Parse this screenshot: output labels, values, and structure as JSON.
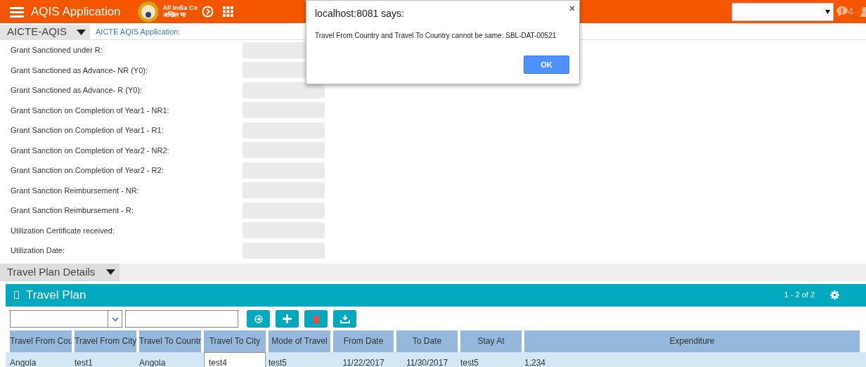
{
  "header": {
    "title": "AQIS Application",
    "logo_lines": [
      "All India Co",
      "अखिल भा"
    ],
    "notification_count": "4"
  },
  "breadcrumb": {
    "screen": "AICTE-AQIS",
    "view": "AICTE AQIS Application:"
  },
  "form_fields": [
    {
      "label": "Grant Sanctioned under R:"
    },
    {
      "label": "Grant Sanctioned as Advance- NR (Y0):"
    },
    {
      "label": "Grant Sanctioned as Advance- R (Y0):"
    },
    {
      "label": "Grant Sanction on Completion of Year1 - NR1:"
    },
    {
      "label": "Grant Sanction on Completion of Year1 - R1:"
    },
    {
      "label": "Grant Sanction on Completion of Year2 - NR2:"
    },
    {
      "label": "Grant Sanction on Completion of Year2 - R2:"
    },
    {
      "label": "Grant Sanction Reimbursement - NR:"
    },
    {
      "label": "Grant Sanction Reimbursement - R:"
    },
    {
      "label": "Utilization Certificate received:"
    },
    {
      "label": "Utilization Date:"
    }
  ],
  "section": {
    "title": "Travel Plan Details"
  },
  "applet": {
    "title": "Travel Plan",
    "record_count": "1 - 2 of 2",
    "columns": [
      "Travel From Cou",
      "Travel From City",
      "Travel To Countr",
      "Travel To City",
      "Mode of Travel",
      "From Date",
      "To Date",
      "Stay At",
      "Expenditure"
    ],
    "rows": [
      {
        "selected": true,
        "cells": [
          {
            "text": "Angola",
            "editing": false
          },
          {
            "text": "test1",
            "editing": false
          },
          {
            "text": "Angola",
            "editing": false
          },
          {
            "text": "test4",
            "editing": true
          },
          {
            "text": "test5",
            "editing": false
          },
          {
            "text": "11/22/2017",
            "editing": false
          },
          {
            "text": "11/30/2017",
            "editing": false
          },
          {
            "text": "test5",
            "editing": false
          },
          {
            "text": "1,234",
            "editing": false
          }
        ]
      }
    ]
  },
  "dialog": {
    "title": "localhost:8081 says:",
    "message": "Travel From Country and Travel To Country cannot be same: SBL-DAT-00521",
    "buttons": [
      "OK"
    ]
  }
}
